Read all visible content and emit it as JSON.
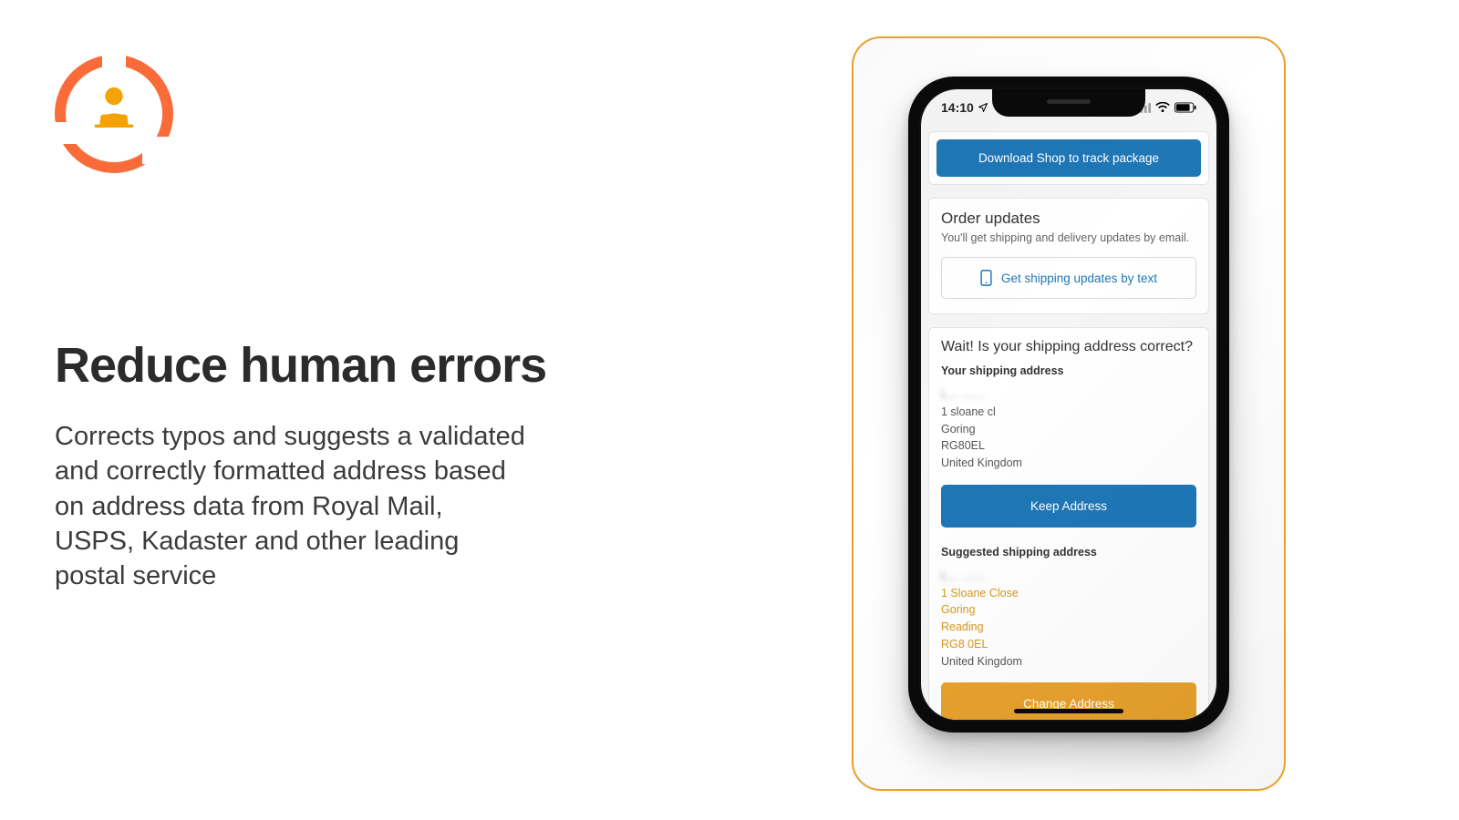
{
  "left": {
    "headline": "Reduce human errors",
    "body": "Corrects typos and suggests a validated and correctly formatted address based on address data from Royal Mail, USPS, Kadaster and other leading postal service"
  },
  "phone": {
    "time": "14:10",
    "download_btn": "Download Shop to track package",
    "updates": {
      "title": "Order updates",
      "subtitle": "You'll get shipping and delivery updates by email.",
      "text_updates_btn": "Get shipping updates by text"
    },
    "validate": {
      "title": "Wait! Is your shipping address correct?",
      "your_address_label": "Your shipping address",
      "your_address": {
        "name": "L.... .......",
        "line1": "1 sloane cl",
        "city": "Goring",
        "postcode": "RG80EL",
        "country": "United Kingdom"
      },
      "keep_btn": "Keep Address",
      "suggested_label": "Suggested shipping address",
      "suggested": {
        "name": "L.... .......",
        "line1": "1 Sloane Close",
        "city": "Goring",
        "region": "Reading",
        "postcode": "RG8 0EL",
        "country": "United Kingdom"
      },
      "change_btn": "Change Address"
    }
  }
}
